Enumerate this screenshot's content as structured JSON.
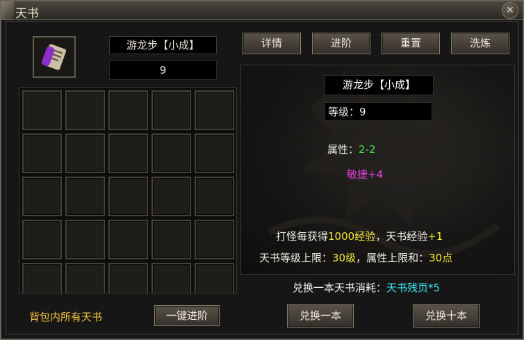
{
  "window": {
    "title": "天书",
    "close_icon": "close-icon"
  },
  "book": {
    "icon": "scroll-book-icon",
    "name": "游龙步【小成】",
    "level_value": "9"
  },
  "top_buttons": [
    {
      "label": "详情"
    },
    {
      "label": "进阶"
    },
    {
      "label": "重置"
    },
    {
      "label": "洗炼"
    }
  ],
  "detail": {
    "name": "游龙步【小成】",
    "level_label": "等级：",
    "level_value": "9",
    "attr_label": "属性：",
    "attr_value": "2-2",
    "stat_text": "敏捷+4",
    "kill_text_1": "打怪每获得",
    "kill_exp": "1000经验",
    "kill_text_2": "，天书经验",
    "kill_gain": "+1",
    "limit_text_1": "天书等级上限：",
    "limit_level": "30级",
    "limit_text_2": "，属性上限和：",
    "limit_points": "30点"
  },
  "exchange": {
    "cost_label": "兑换一本天书消耗：",
    "cost_value": "天书残页*5",
    "one_label": "兑换一本",
    "ten_label": "兑换十本"
  },
  "bag": {
    "label": "背包内所有天书",
    "upgrade_all_label": "一键进阶",
    "rows": 5,
    "cols": 5
  },
  "colors": {
    "green": "#3ee64a",
    "magenta": "#e040e0",
    "yellow": "#f7ea3b",
    "cyan": "#3ee6f0",
    "gold": "#f0c43c"
  }
}
